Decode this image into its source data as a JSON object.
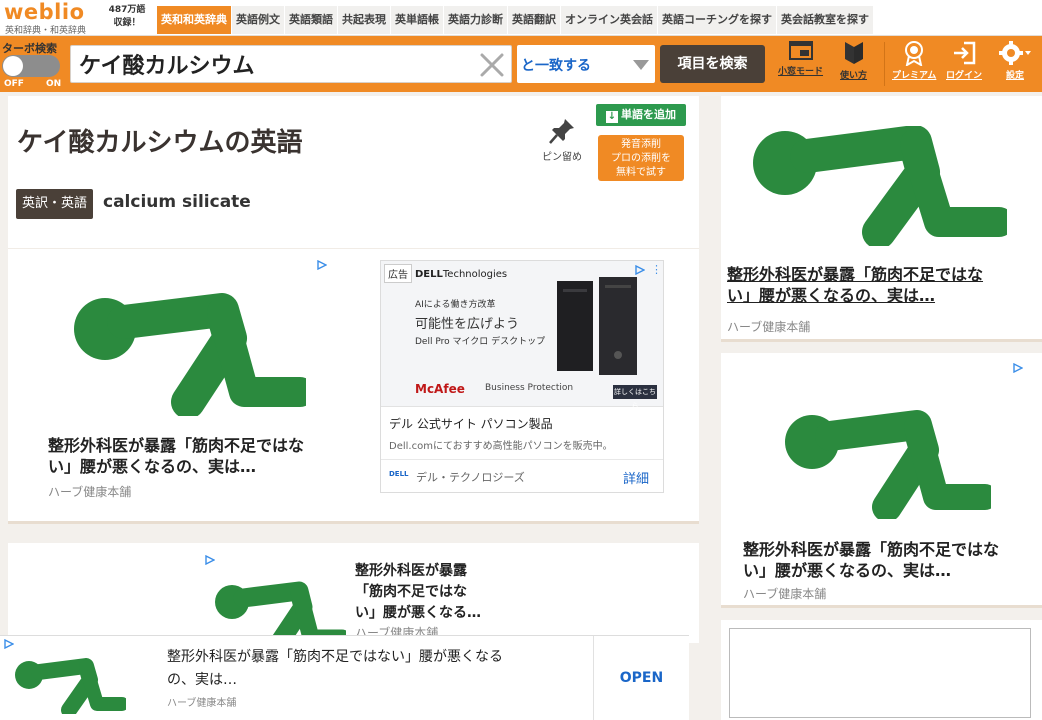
{
  "header": {
    "logo": "weblio",
    "logo_sub": "英和辞典・和英辞典",
    "word_count": "487万語",
    "word_count_sub": "収録！",
    "tabs": [
      {
        "label": "英和和英辞典",
        "active": true
      },
      {
        "label": "英語例文"
      },
      {
        "label": "英語類語"
      },
      {
        "label": "共起表現"
      },
      {
        "label": "英単語帳"
      },
      {
        "label": "英語力診断"
      },
      {
        "label": "英語翻訳"
      },
      {
        "label": "オンライン英会話"
      },
      {
        "label": "英語コーチングを探す"
      },
      {
        "label": "英会話教室を探す"
      }
    ]
  },
  "search": {
    "turbo_label": "ターボ検索",
    "toggle_off": "OFF",
    "toggle_on": "ON",
    "query": "ケイ酸カルシウム",
    "match_mode": "と一致する",
    "button": "項目を検索",
    "tools": {
      "small_window": "小窓モード",
      "howto": "使い方",
      "premium": "プレミアム",
      "login": "ログイン",
      "settings": "設定"
    }
  },
  "entry": {
    "title": "ケイ酸カルシウムの英語",
    "pin_label": "ピン留め",
    "add_word": "単語を追加",
    "coach_line1": "発音添削",
    "coach_line2": "プロの添削を",
    "coach_line3": "無料で試す",
    "tag": "英訳・英語",
    "translation": "calcium silicate"
  },
  "ads": {
    "herb_headline": "整形外科医が暴露「筋肉不足ではない」腰が悪くなるの、実は…",
    "herb_line1": "整形外科医が暴露「筋肉不足ではな",
    "herb_line2": "い」腰が悪くなるの、実は…",
    "herb_line1_narrow": "整形外科医が暴露",
    "herb_line2_narrow": "「筋肉不足ではな",
    "herb_line3_narrow": "い」腰が悪くなる…",
    "sticky_line1": "整形外科医が暴露「筋肉不足ではない」腰が悪くなる",
    "sticky_line2": "の、実は…",
    "herb_source": "ハーブ健康本舗",
    "figure_color": "#2b8a3e",
    "dell": {
      "badge": "広告",
      "brand": "Technologies",
      "brand_bold": "DELL",
      "small": "AIによる働き方改革",
      "big": "可能性を広げよう",
      "model": "Dell Pro マイクロ デスクトップ",
      "mcafee": "McAfee",
      "mcafee_sub": "Business Protection",
      "cta": "詳しくはこちら",
      "title": "デル 公式サイト パソコン製品",
      "desc": "Dell.comにておすすめ高性能パソコンを販売中。",
      "logo_small": "DELL",
      "advertiser": "デル・テクノロジーズ",
      "detail": "詳細"
    },
    "open": "OPEN"
  },
  "colors": {
    "accent": "#f08a24",
    "dark": "#4a4038",
    "green": "#2d9a4e",
    "link": "#1a66c8"
  }
}
